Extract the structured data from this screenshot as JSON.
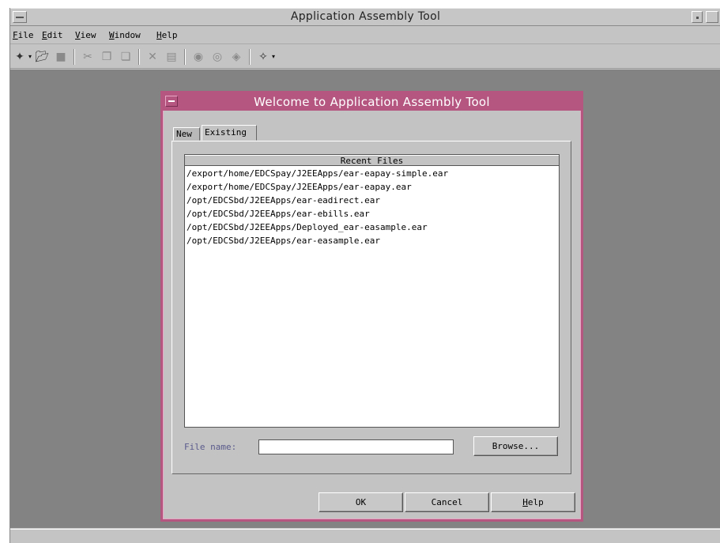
{
  "window": {
    "title": "Application Assembly Tool"
  },
  "menubar": {
    "items": [
      "File",
      "Edit",
      "View",
      "Window",
      "Help"
    ]
  },
  "toolbar": {
    "icons": [
      "new-icon",
      "open-icon",
      "save-icon",
      "cut-icon",
      "copy-icon",
      "paste-icon",
      "delete-icon",
      "properties-icon",
      "generate-code-icon",
      "verify-icon",
      "deploy-icon",
      "wizard-icon"
    ]
  },
  "dialog": {
    "title": "Welcome to Application Assembly Tool",
    "tabs": [
      {
        "label": "New",
        "selected": false
      },
      {
        "label": "Existing",
        "selected": true
      }
    ],
    "recent_files": {
      "header": "Recent Files",
      "items": [
        "/export/home/EDCSpay/J2EEApps/ear-eapay-simple.ear",
        "/export/home/EDCSpay/J2EEApps/ear-eapay.ear",
        "/opt/EDCSbd/J2EEApps/ear-eadirect.ear",
        "/opt/EDCSbd/J2EEApps/ear-ebills.ear",
        "/opt/EDCSbd/J2EEApps/Deployed_ear-easample.ear",
        "/opt/EDCSbd/J2EEApps/ear-easample.ear"
      ]
    },
    "file_name": {
      "label": "File name:",
      "value": ""
    },
    "buttons": {
      "browse": "Browse...",
      "ok": "OK",
      "cancel": "Cancel",
      "help": "Help"
    }
  },
  "colors": {
    "dialog_accent": "#b45680",
    "desktop": "#838383",
    "chrome": "#c4c4c4"
  }
}
